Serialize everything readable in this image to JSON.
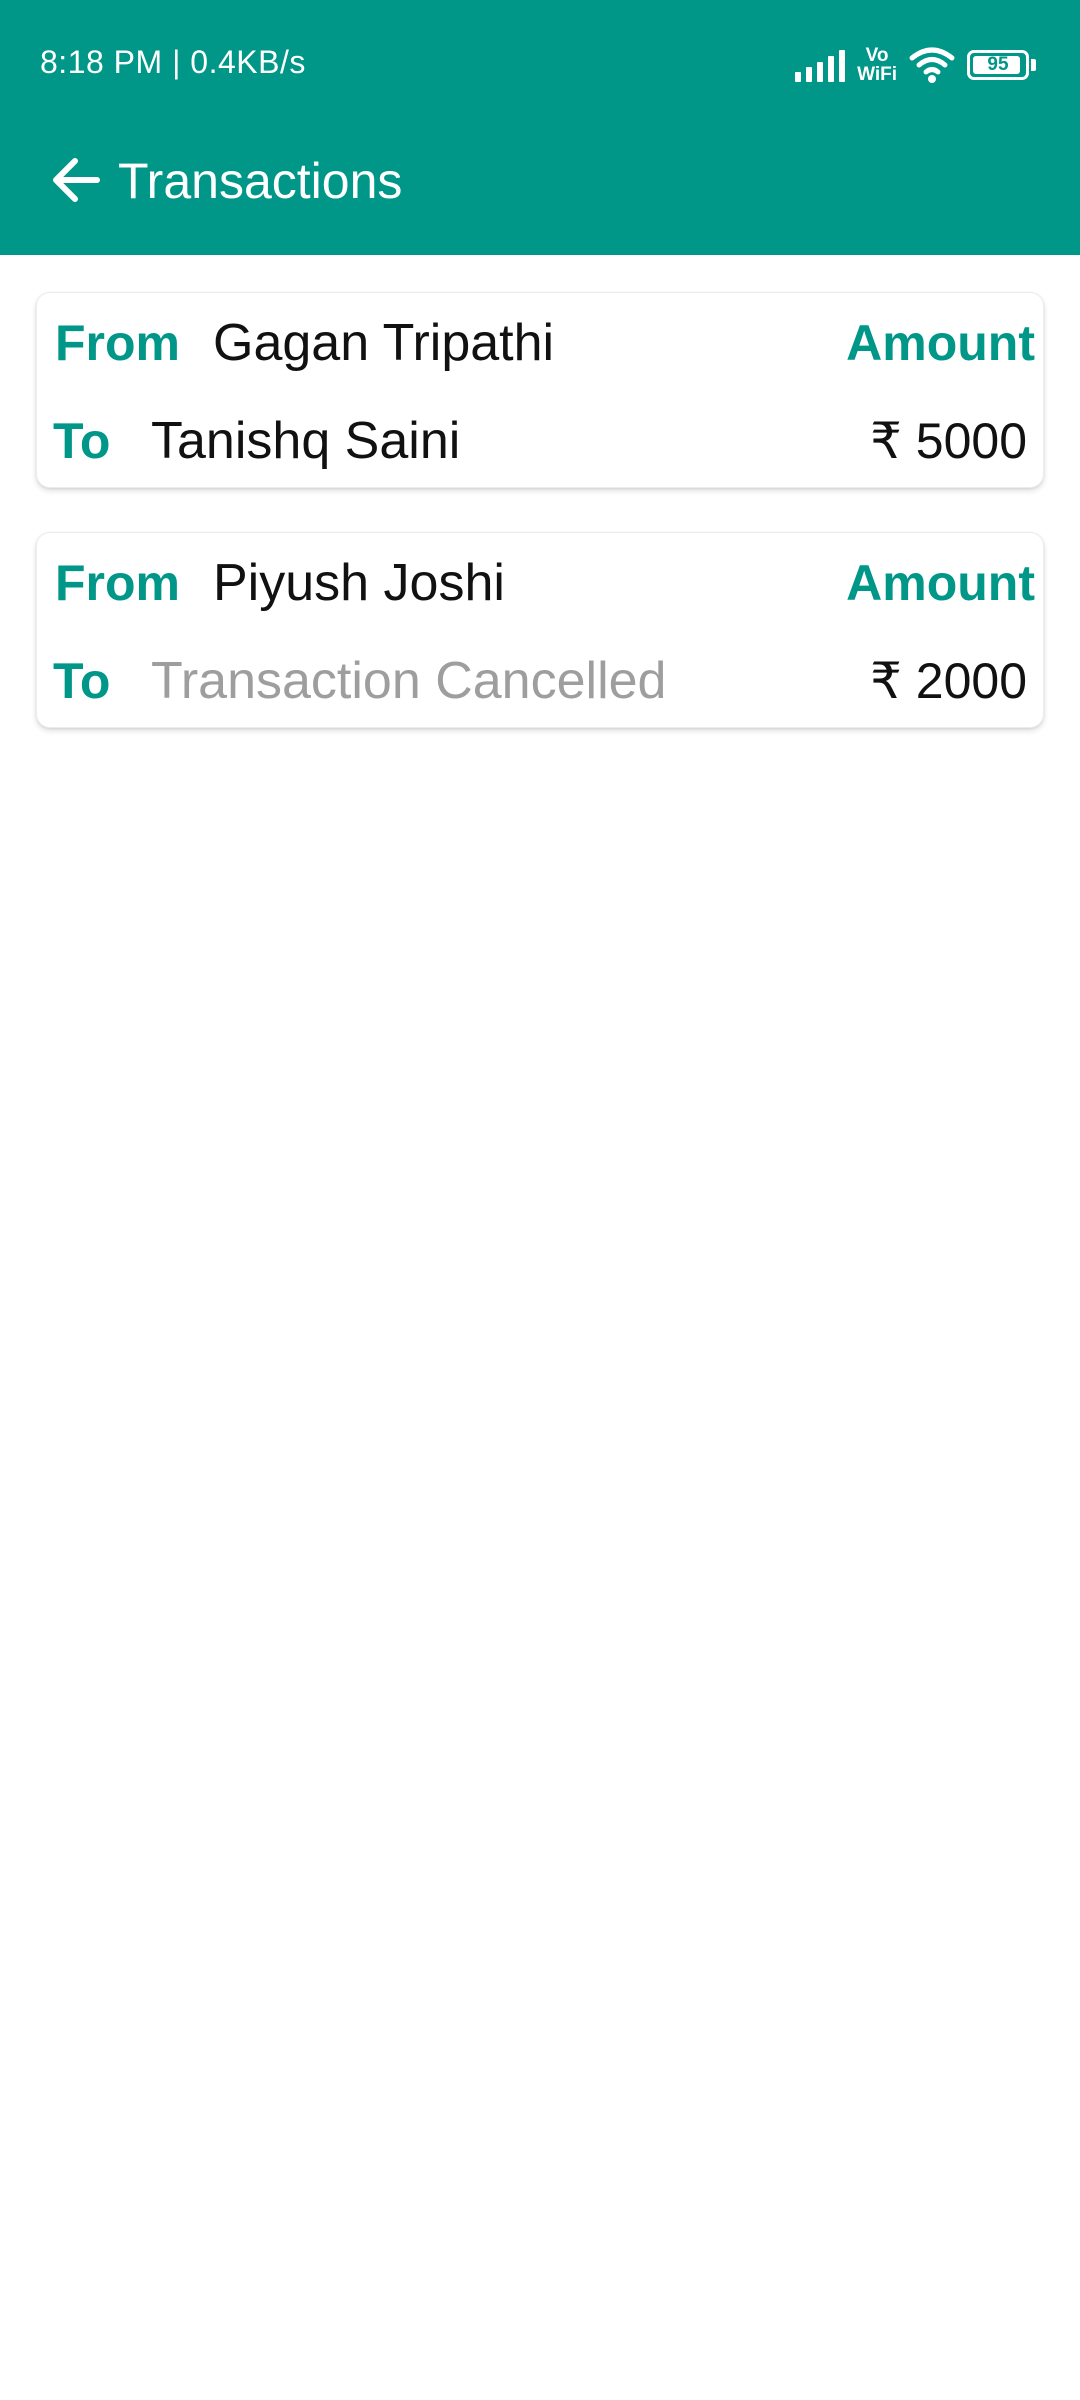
{
  "status_bar": {
    "time": "8:18 PM | 0.4KB/s",
    "vowifi_line1": "Vo",
    "vowifi_line2": "WiFi",
    "battery_level": "95",
    "battery_fraction": 0.95
  },
  "app_bar": {
    "title": "Transactions",
    "back_icon": "arrow-left-icon",
    "color": "#009688"
  },
  "labels": {
    "from": "From",
    "to": "To",
    "amount": "Amount"
  },
  "transactions": [
    {
      "from": "Gagan Tripathi",
      "to": "Tanishq Saini",
      "amount": "₹ 5000",
      "cancelled": false
    },
    {
      "from": "Piyush Joshi",
      "to": "Transaction Cancelled",
      "amount": "₹ 2000",
      "cancelled": true
    }
  ],
  "colors": {
    "accent": "#009688",
    "cancelled_text": "#9e9e9e"
  }
}
